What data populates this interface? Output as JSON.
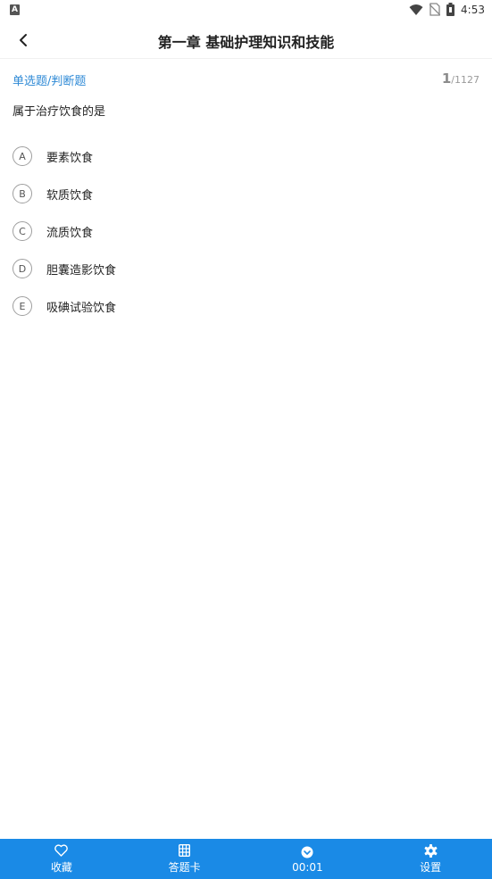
{
  "status_bar": {
    "time": "4:53",
    "app_badge": "A"
  },
  "header": {
    "title": "第一章 基础护理知识和技能"
  },
  "question": {
    "type_label": "单选题/判断题",
    "current": "1",
    "total": "/1127",
    "text": "属于治疗饮食的是",
    "options": [
      {
        "letter": "A",
        "text": "要素饮食"
      },
      {
        "letter": "B",
        "text": "软质饮食"
      },
      {
        "letter": "C",
        "text": "流质饮食"
      },
      {
        "letter": "D",
        "text": "胆囊造影饮食"
      },
      {
        "letter": "E",
        "text": "吸碘试验饮食"
      }
    ]
  },
  "bottom_bar": {
    "favorite_label": "收藏",
    "answer_card_label": "答题卡",
    "timer": "00:01",
    "settings_label": "设置",
    "accent_color": "#1a8ae6"
  }
}
